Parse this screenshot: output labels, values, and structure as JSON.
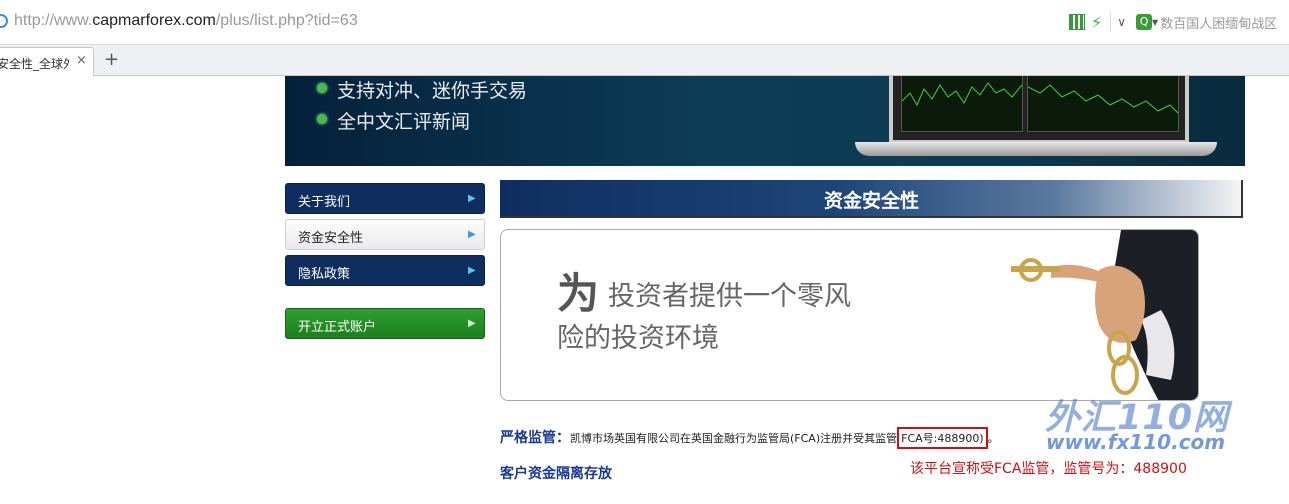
{
  "browser": {
    "url_prefix": "http://www.",
    "url_domain": "capmarforex.com",
    "url_path": "/plus/list.php?tid=63",
    "search_placeholder": "数百国人困缅甸战区",
    "tab_title": "安全性_全球外",
    "tab_close": "×",
    "new_tab": "+"
  },
  "banner": {
    "features": [
      "支持对冲、迷你手交易",
      "全中文汇评新闻"
    ]
  },
  "sidebar": {
    "items": [
      {
        "label": "关于我们",
        "style": "dark"
      },
      {
        "label": "资金安全性",
        "style": "light"
      },
      {
        "label": "隐私政策",
        "style": "dark"
      },
      {
        "label": "开立正式账户",
        "style": "green"
      }
    ],
    "arrow": "▶"
  },
  "section": {
    "title": "资金安全性"
  },
  "hero": {
    "big_char": "为",
    "line1": "投资者提供一个零风",
    "line2": "险的投资环境"
  },
  "content": {
    "reg_label": "严格监管：",
    "reg_text": "凯博市场英国有限公司在英国金融行为监管局(FCA)注册并受其监管",
    "reg_highlight": "FCA号:488900)",
    "reg_tail": "。",
    "segregation_title": "客户资金隔离存放"
  },
  "watermark": {
    "logo": "外汇110网",
    "url": "www.fx110.com"
  },
  "annotation": {
    "note": "该平台宣称受FCA监管，监管号为：488900"
  },
  "colors": {
    "nav_dark": "#0f2e5f",
    "nav_green": "#1d7e1d",
    "heading_blue": "#1a3a8f",
    "highlight_red": "#d01010"
  }
}
